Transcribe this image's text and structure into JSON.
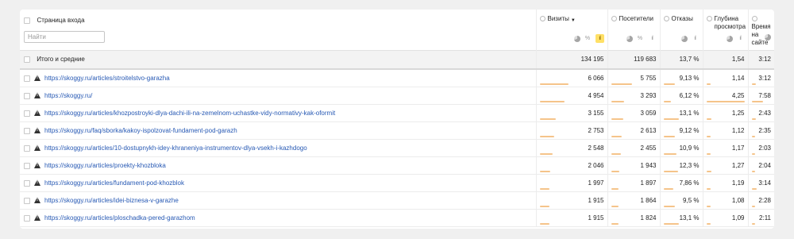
{
  "header": {
    "entry_page_label": "Страница входа",
    "search_placeholder": "Найти",
    "columns": [
      {
        "label": "Визиты",
        "sorted": true,
        "sort_glyph": "▼"
      },
      {
        "label": "Посетители"
      },
      {
        "label": "Отказы"
      },
      {
        "label": "Глубина просмотра"
      },
      {
        "label": "Время на сайте"
      }
    ],
    "view_icons": [
      "pie-chart-icon",
      "percent-icon",
      "bar-chart-icon"
    ],
    "percent_glyph": "%",
    "bars_glyph": "ıl"
  },
  "totals": {
    "label": "Итого и средние",
    "values": [
      "134 195",
      "119 683",
      "13,7 %",
      "1,54",
      "3:12"
    ]
  },
  "rows": [
    {
      "url": "https://skoggy.ru/articles/stroitelstvo-garazha",
      "values": [
        "6 066",
        "5 755",
        "9,13 %",
        "1,14",
        "3:12"
      ]
    },
    {
      "url": "https://skoggy.ru/",
      "values": [
        "4 954",
        "3 293",
        "6,12 %",
        "4,25",
        "7:58"
      ]
    },
    {
      "url": "https://skoggy.ru/articles/khozpostroyki-dlya-dachi-ili-na-zemelnom-uchastke-vidy-normativy-kak-oformit",
      "values": [
        "3 155",
        "3 059",
        "13,1 %",
        "1,25",
        "2:43"
      ]
    },
    {
      "url": "https://skoggy.ru/faq/sborka/kakoy-ispolzovat-fundament-pod-garazh",
      "values": [
        "2 753",
        "2 613",
        "9,12 %",
        "1,12",
        "2:35"
      ]
    },
    {
      "url": "https://skoggy.ru/articles/10-dostupnykh-idey-khraneniya-instrumentov-dlya-vsekh-i-kazhdogo",
      "values": [
        "2 548",
        "2 455",
        "10,9 %",
        "1,17",
        "2:03"
      ]
    },
    {
      "url": "https://skoggy.ru/articles/proekty-khozbloka",
      "values": [
        "2 046",
        "1 943",
        "12,3 %",
        "1,27",
        "2:04"
      ]
    },
    {
      "url": "https://skoggy.ru/articles/fundament-pod-khozblok",
      "values": [
        "1 997",
        "1 897",
        "7,86 %",
        "1,19",
        "3:14"
      ]
    },
    {
      "url": "https://skoggy.ru/articles/idei-biznesa-v-garazhe",
      "values": [
        "1 915",
        "1 864",
        "9,5 %",
        "1,08",
        "2:28"
      ]
    },
    {
      "url": "https://skoggy.ru/articles/ploschadka-pered-garazhom",
      "values": [
        "1 915",
        "1 824",
        "13,1 %",
        "1,09",
        "2:11"
      ]
    }
  ],
  "bar_fractions": [
    [
      0.45,
      0.45,
      0.3,
      0.1,
      0.2
    ],
    [
      0.38,
      0.28,
      0.2,
      1.0,
      0.55
    ],
    [
      0.25,
      0.26,
      0.42,
      0.12,
      0.18
    ],
    [
      0.22,
      0.23,
      0.3,
      0.1,
      0.17
    ],
    [
      0.2,
      0.21,
      0.36,
      0.11,
      0.14
    ],
    [
      0.16,
      0.17,
      0.4,
      0.12,
      0.14
    ],
    [
      0.15,
      0.16,
      0.26,
      0.11,
      0.22
    ],
    [
      0.15,
      0.16,
      0.31,
      0.1,
      0.17
    ],
    [
      0.15,
      0.16,
      0.42,
      0.1,
      0.15
    ]
  ],
  "colors": {
    "link": "#2759b4",
    "bar": "#f5c48a",
    "active_icon": "#ffe066"
  }
}
